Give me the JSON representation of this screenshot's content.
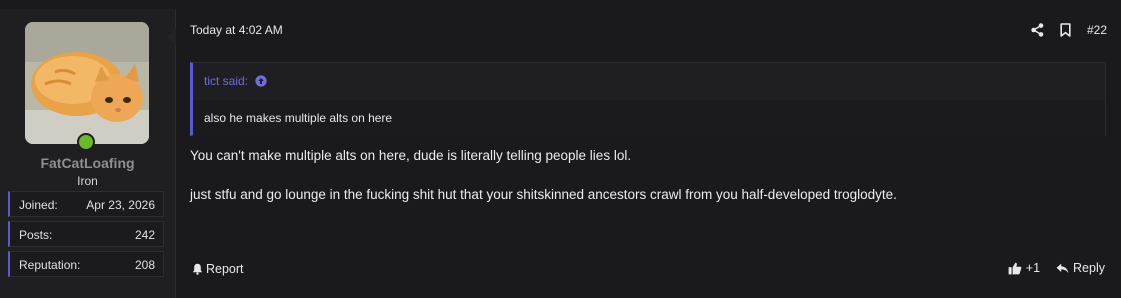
{
  "user": {
    "username": "FatCatLoafing",
    "title": "Iron",
    "online": true,
    "stats": [
      {
        "label": "Joined:",
        "value": "Apr 23, 2026"
      },
      {
        "label": "Posts:",
        "value": "242"
      },
      {
        "label": "Reputation:",
        "value": "208"
      }
    ]
  },
  "post": {
    "timestamp": "Today at 4:02 AM",
    "number": "#22",
    "quote": {
      "author_label": "tict said:",
      "text": "also he makes multiple alts on here"
    },
    "message": [
      "You can't make multiple alts on here, dude is literally telling people lies lol.",
      "just stfu and go lounge in the fucking shit hut that your shitskinned ancestors crawl from you half-developed troglodyte."
    ],
    "actions": {
      "report_label": "Report",
      "like_label": "+1",
      "reply_label": "Reply"
    }
  },
  "colors": {
    "accent": "#5b5ad0",
    "online": "#6ab82b",
    "background": "#1a1a1c"
  },
  "icons": {
    "share": "share-icon",
    "bookmark": "bookmark-icon",
    "jump": "arrow-up-circle-icon",
    "report": "bell-icon",
    "like": "thumbs-up-icon",
    "reply": "reply-icon"
  }
}
